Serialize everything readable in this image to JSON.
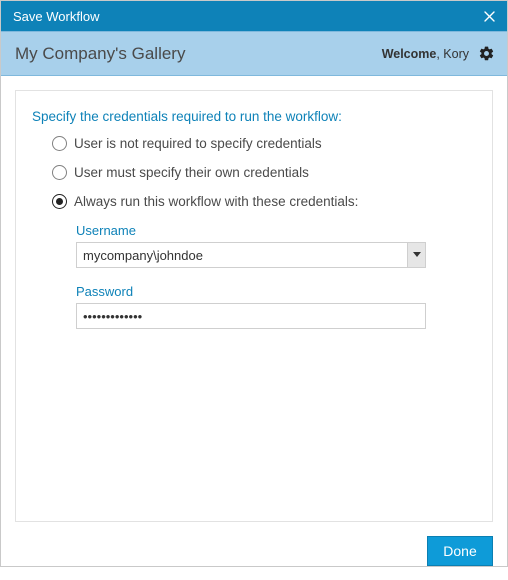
{
  "titlebar": {
    "title": "Save Workflow"
  },
  "subheader": {
    "gallery_title": "My Company's Gallery",
    "welcome_label": "Welcome",
    "user_name": "Kory"
  },
  "form": {
    "instruction": "Specify the credentials required to run the workflow:",
    "options": [
      {
        "label": "User is not required to specify credentials"
      },
      {
        "label": "User must specify their own credentials"
      },
      {
        "label": "Always run this workflow with these credentials:"
      }
    ],
    "selected_index": 2,
    "username_label": "Username",
    "username_value": "mycompany\\johndoe",
    "password_label": "Password",
    "password_value": "•••••••••••••"
  },
  "footer": {
    "done_label": "Done"
  }
}
